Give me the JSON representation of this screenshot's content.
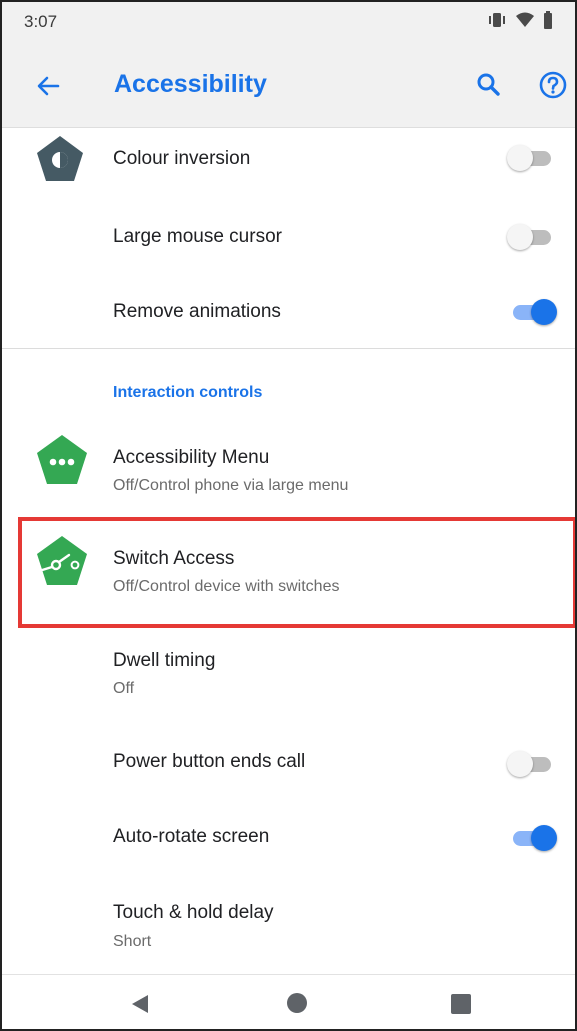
{
  "status_bar": {
    "time": "3:07",
    "icons": [
      "vibrate-icon",
      "wifi-icon",
      "battery-icon"
    ]
  },
  "app_bar": {
    "title": "Accessibility",
    "icons": [
      "back-arrow-icon",
      "search-icon",
      "help-icon"
    ],
    "accent_color": "#1a73e8"
  },
  "settings": {
    "colour_inversion": {
      "label": "Colour inversion",
      "toggle": false
    },
    "large_mouse_cursor": {
      "label": "Large mouse cursor",
      "toggle": false
    },
    "remove_animations": {
      "label": "Remove animations",
      "toggle": true
    },
    "section_header": "Interaction controls",
    "accessibility_menu": {
      "label": "Accessibility Menu",
      "summary": "Off/Control phone via large menu"
    },
    "switch_access": {
      "label": "Switch Access",
      "summary": "Off/Control device with switches",
      "highlighted": true,
      "highlight_color": "#e53935"
    },
    "dwell_timing": {
      "label": "Dwell timing",
      "summary": "Off"
    },
    "power_button_ends_call": {
      "label": "Power button ends call",
      "toggle": false
    },
    "auto_rotate_screen": {
      "label": "Auto-rotate screen",
      "toggle": true
    },
    "touch_hold_delay": {
      "label": "Touch & hold delay",
      "summary": "Short"
    }
  },
  "nav_bar": {
    "icons": [
      "nav-back-icon",
      "nav-home-icon",
      "nav-recents-icon"
    ]
  }
}
